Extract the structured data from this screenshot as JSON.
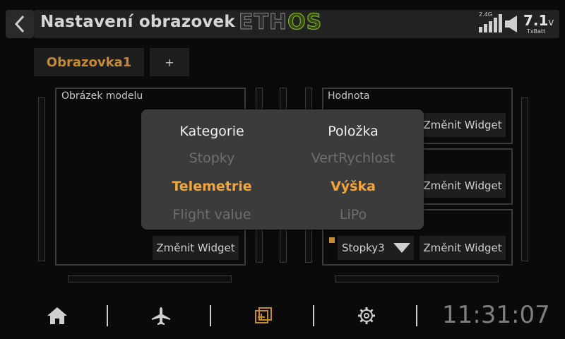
{
  "header": {
    "title": "Nastavení obrazovek",
    "logo_text": {
      "eth": "ETH",
      "os": "OS"
    },
    "signal_label": "2.4G",
    "battery_value": "7.1",
    "battery_unit": "V",
    "battery_label": "TxBatt"
  },
  "tabs": [
    {
      "label": "Obrazovka1",
      "active": true
    },
    {
      "label": "+"
    }
  ],
  "slots": {
    "left": {
      "label": "Obrázek modelu",
      "button": "Změnit Widget"
    },
    "right": [
      {
        "label": "Hodnota",
        "button": "Změnit Widget"
      },
      {
        "label": "",
        "button": "Změnit Widget"
      },
      {
        "label": "",
        "button": "Změnit Widget",
        "select_value": "Stopky3"
      }
    ]
  },
  "popup": {
    "category": {
      "header": "Kategorie",
      "items": [
        "Stopky",
        "Telemetrie",
        "Flight value"
      ],
      "selected": "Telemetrie"
    },
    "item": {
      "header": "Položka",
      "items": [
        "VertRychlost",
        "Výška",
        "LiPo"
      ],
      "selected": "Výška"
    }
  },
  "nav": {
    "icons": [
      "home-icon",
      "airplane-icon",
      "screens-icon",
      "gear-icon"
    ],
    "active": "screens-icon",
    "clock": "11:31:07"
  },
  "colors": {
    "accent": "#f2a53b",
    "tab_active": "#c68a35",
    "logo_os": "#7fb02a"
  }
}
